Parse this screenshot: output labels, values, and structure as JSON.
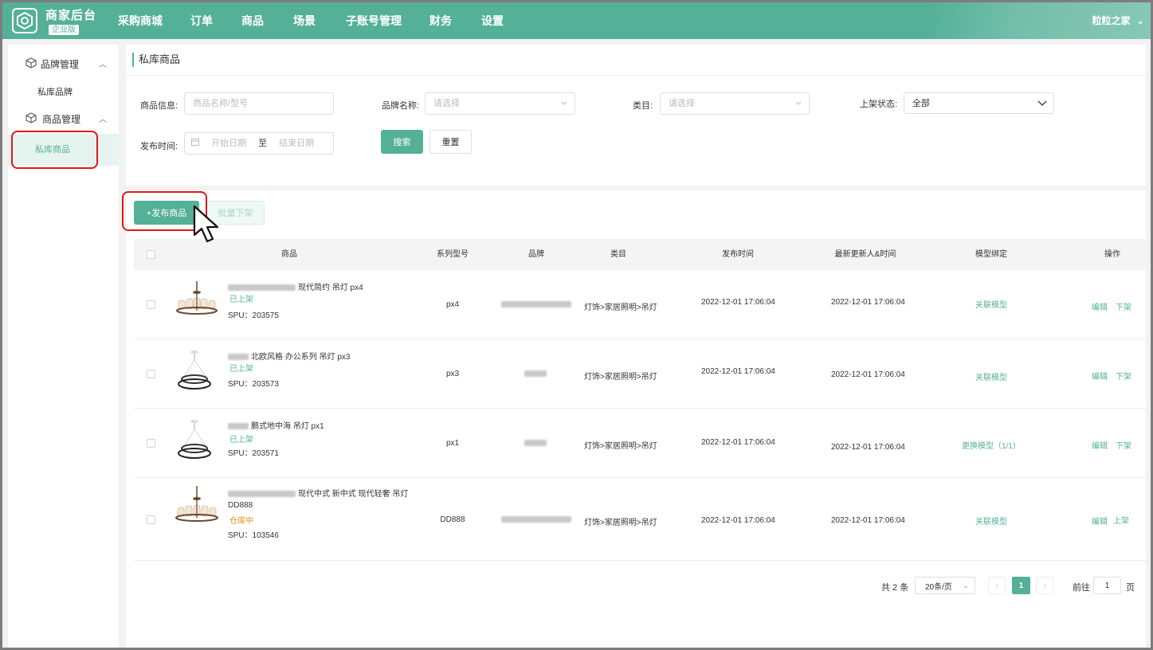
{
  "header": {
    "brand_title": "商家后台",
    "brand_badge": "企业版",
    "nav": [
      "采购商城",
      "订单",
      "商品",
      "场景",
      "子账号管理",
      "财务",
      "设置"
    ],
    "active_nav": "商品",
    "user": "粒粒之家"
  },
  "sidebar": {
    "groups": [
      {
        "label": "品牌管理",
        "items": [
          "私库品牌"
        ]
      },
      {
        "label": "商品管理",
        "items": [
          "私库商品"
        ]
      }
    ],
    "active_item": "私库商品"
  },
  "page": {
    "title": "私库商品"
  },
  "filters": {
    "product_info_label": "商品信息:",
    "product_info_placeholder": "商品名称/型号",
    "brand_label": "品牌名称:",
    "brand_placeholder": "请选择",
    "category_label": "类目:",
    "category_placeholder": "请选择",
    "status_label": "上架状态:",
    "status_value": "全部",
    "publish_label": "发布时间:",
    "start_placeholder": "开始日期",
    "to": "至",
    "end_placeholder": "结束日期",
    "search_button": "搜索",
    "reset_button": "重置"
  },
  "actions": {
    "publish": "+发布商品",
    "bulk_off": "批量下架"
  },
  "table": {
    "headers": [
      "商品",
      "系列型号",
      "品牌",
      "类目",
      "发布时间",
      "最新更新人&时间",
      "模型绑定",
      "操作"
    ],
    "rows": [
      {
        "name": "现代简约 吊灯 px4",
        "model_line": "",
        "status": "已上架",
        "status_color": "#54b097",
        "spu": "SPU：203575",
        "series": "px4",
        "category": "灯饰>家居照明>吊灯",
        "published": "2022-12-01 17:06:04",
        "updated": "2022-12-01 17:06:04",
        "model": "关联模型",
        "edit": "编辑",
        "toggle": "下架"
      },
      {
        "name": "北欧风格 办公系列 吊灯 px3",
        "model_line": "",
        "status": "已上架",
        "status_color": "#54b097",
        "spu": "SPU：203573",
        "series": "px3",
        "category": "灯饰>家居照明>吊灯",
        "published": "2022-12-01 17:06:04",
        "updated": "2022-12-01 17:06:04",
        "model": "关联模型",
        "edit": "编辑",
        "toggle": "下架"
      },
      {
        "name": "鹏式地中海 吊灯 px1",
        "model_line": "",
        "status": "已上架",
        "status_color": "#54b097",
        "spu": "SPU：203571",
        "series": "px1",
        "category": "灯饰>家居照明>吊灯",
        "published": "2022-12-01 17:06:04",
        "updated": "2022-12-01 17:06:04",
        "model": "更换模型（1/1）",
        "edit": "编辑",
        "toggle": "下架"
      },
      {
        "name": "现代中式 新中式 现代轻奢 吊灯",
        "model_line": "DD888",
        "status": "仓库中",
        "status_color": "#f08a1c",
        "spu": "SPU：103546",
        "series": "DD888",
        "category": "灯饰>家居照明>吊灯",
        "published": "2022-12-01 17:06:04",
        "updated": "2022-12-01 17:06:04",
        "model": "关联模型",
        "edit": "编辑",
        "toggle": "上架"
      }
    ]
  },
  "pagination": {
    "total": "共 2 条",
    "page_size": "20条/页",
    "current": "1",
    "goto_label": "前往",
    "goto_value": "1",
    "page_suffix": "页"
  },
  "colors": {
    "primary": "#54b097",
    "highlight": "#e5141b",
    "warning": "#f08a1c"
  }
}
